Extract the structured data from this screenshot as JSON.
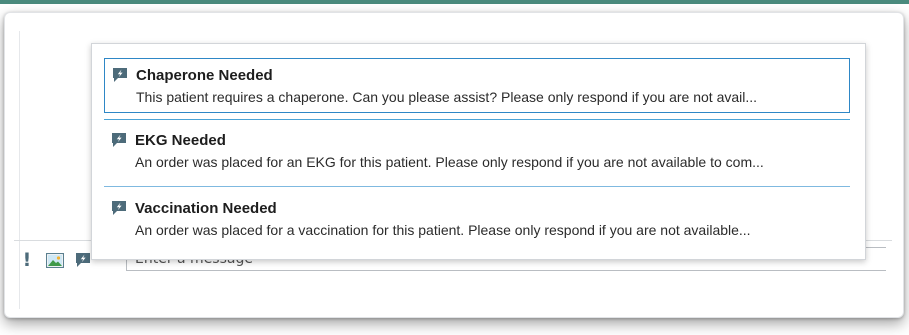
{
  "composer": {
    "placeholder": "Enter a message",
    "tools": [
      "exclamation-icon",
      "image-icon",
      "quick-message-icon"
    ]
  },
  "quick_messages": [
    {
      "title": "Chaperone Needed",
      "description": "This patient requires a chaperone. Can you please assist? Please only respond if you are not avail...",
      "selected": true
    },
    {
      "title": "EKG Needed",
      "description": "An order was placed for an EKG for this patient. Please only respond if you are not available to com...",
      "selected": false
    },
    {
      "title": "Vaccination Needed",
      "description": "An order was placed for a vaccination for this patient. Please only respond if you are not available...",
      "selected": false
    }
  ],
  "colors": {
    "accent_top_rule": "#4a8a7d",
    "selection_border": "#2e87c6",
    "icon_color": "#4d6b7a"
  }
}
